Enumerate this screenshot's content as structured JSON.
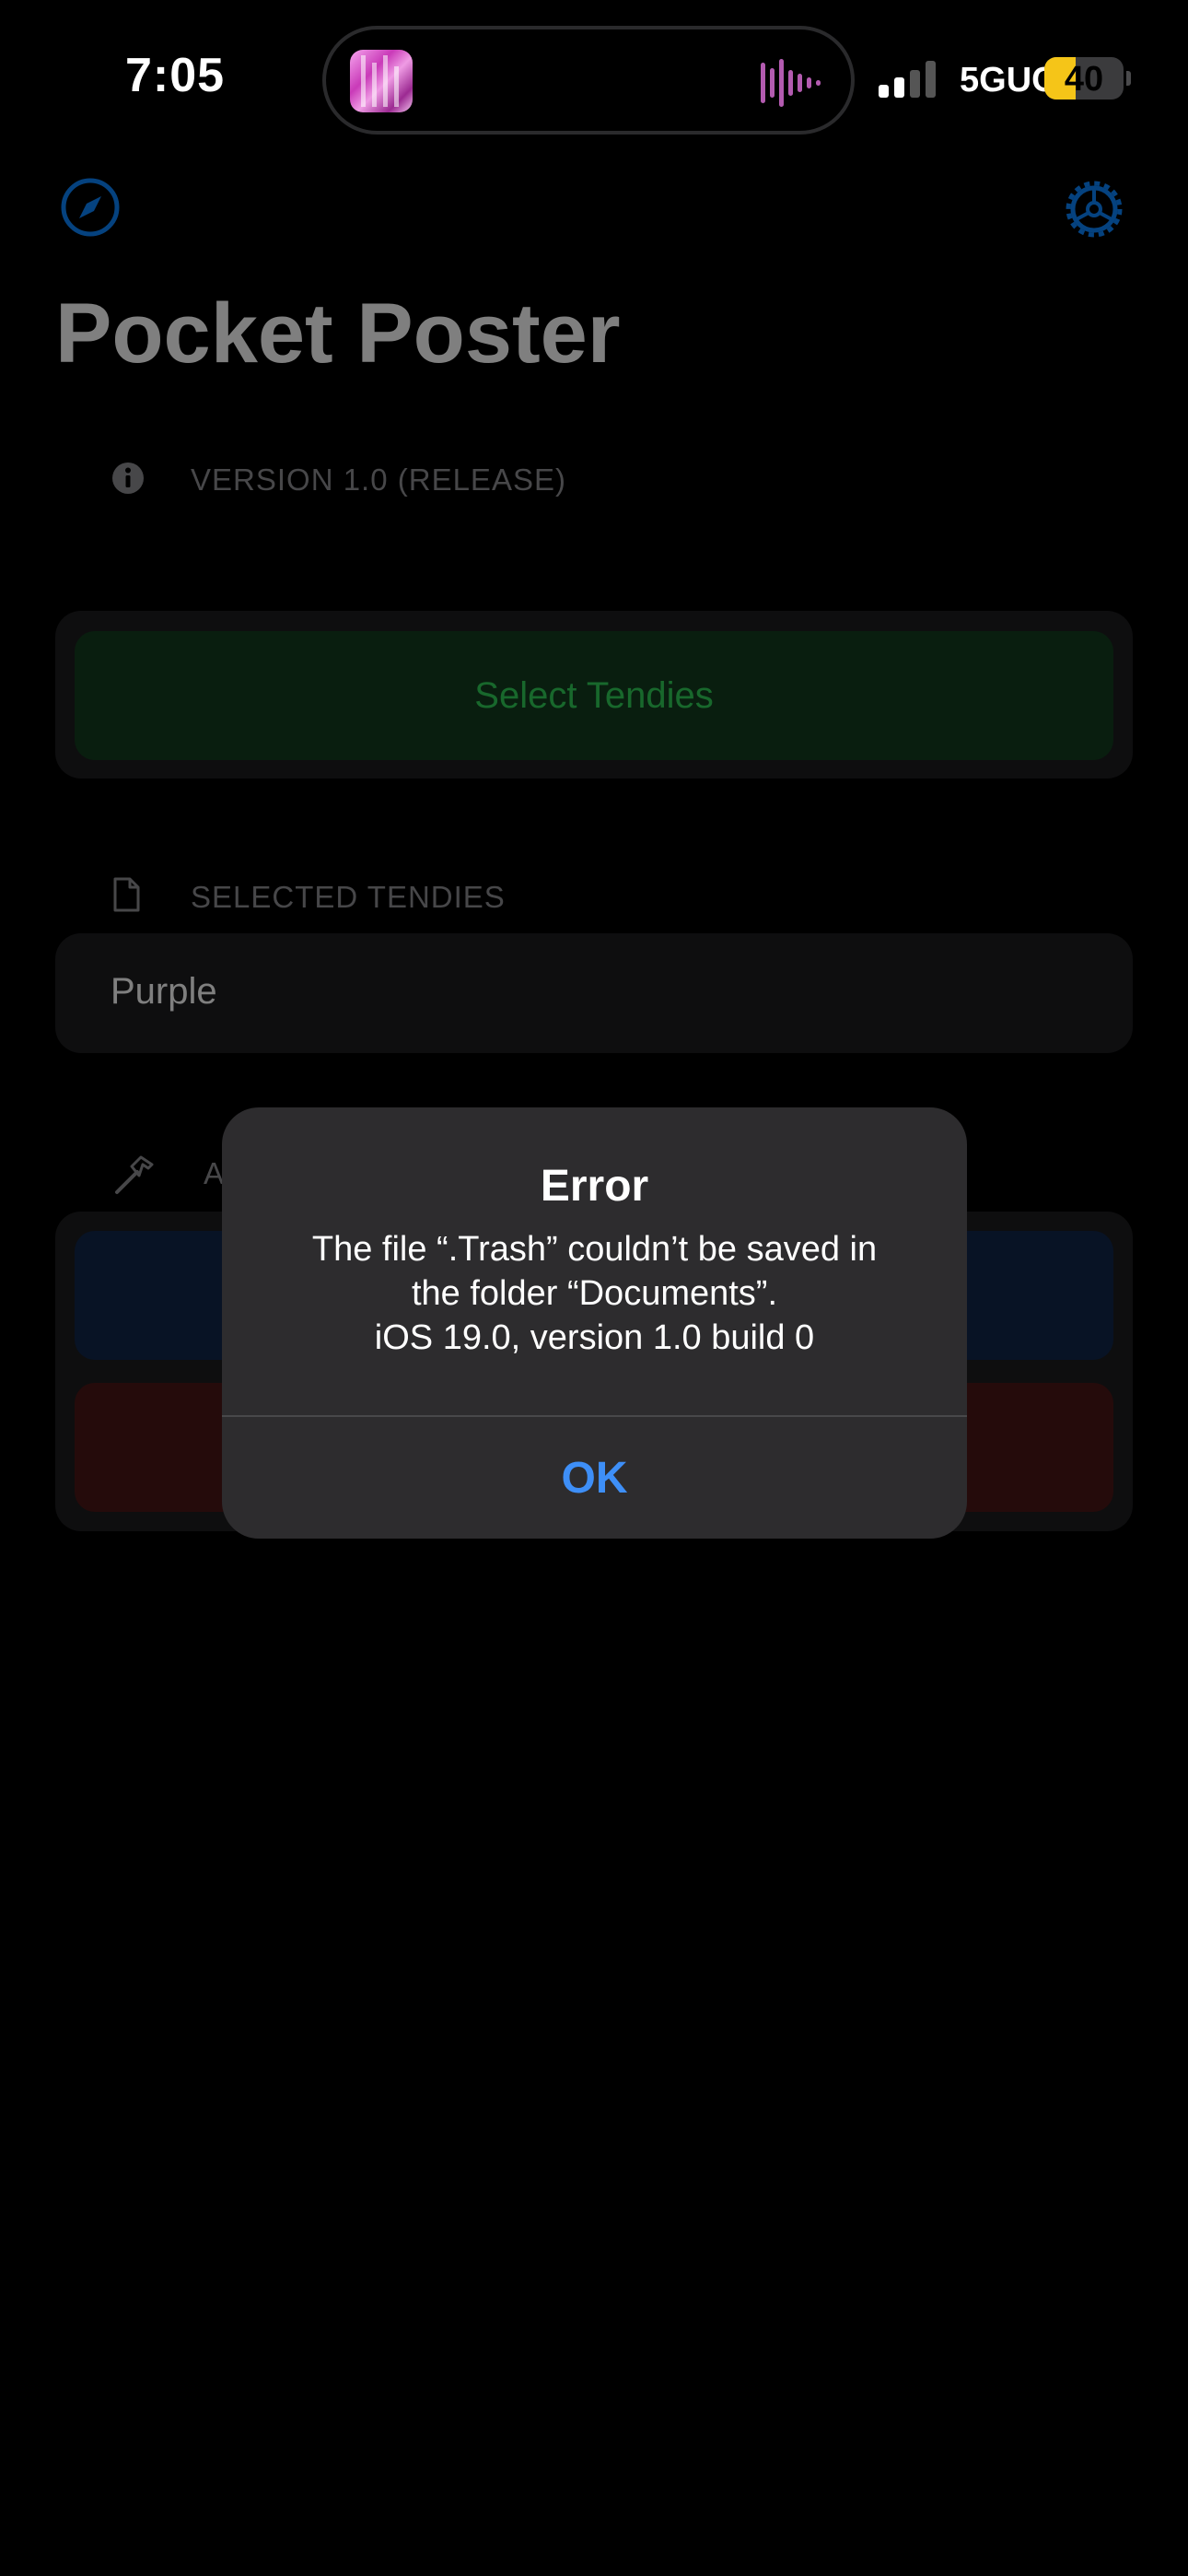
{
  "status_bar": {
    "time": "7:05",
    "network": "5GUC",
    "battery_level": "40",
    "battery_fraction": 0.4
  },
  "nav": {
    "left_icon": "compass-icon",
    "right_icon": "gear-icon"
  },
  "page": {
    "title": "Pocket Poster",
    "version_label": "VERSION 1.0 (RELEASE)",
    "select_button_label": "Select Tendies",
    "selected_section_label": "SELECTED TENDIES",
    "selected_value": "Purple",
    "actions_section_label_partial": "A"
  },
  "alert": {
    "title": "Error",
    "message": "The file “.Trash” couldn’t be saved in\nthe folder “Documents”.\niOS 19.0, version 1.0 build 0",
    "ok_label": "OK"
  },
  "colors": {
    "accent_blue": "#3e8ff7",
    "accent_green": "#30d158",
    "battery_yellow": "#f5c518"
  }
}
